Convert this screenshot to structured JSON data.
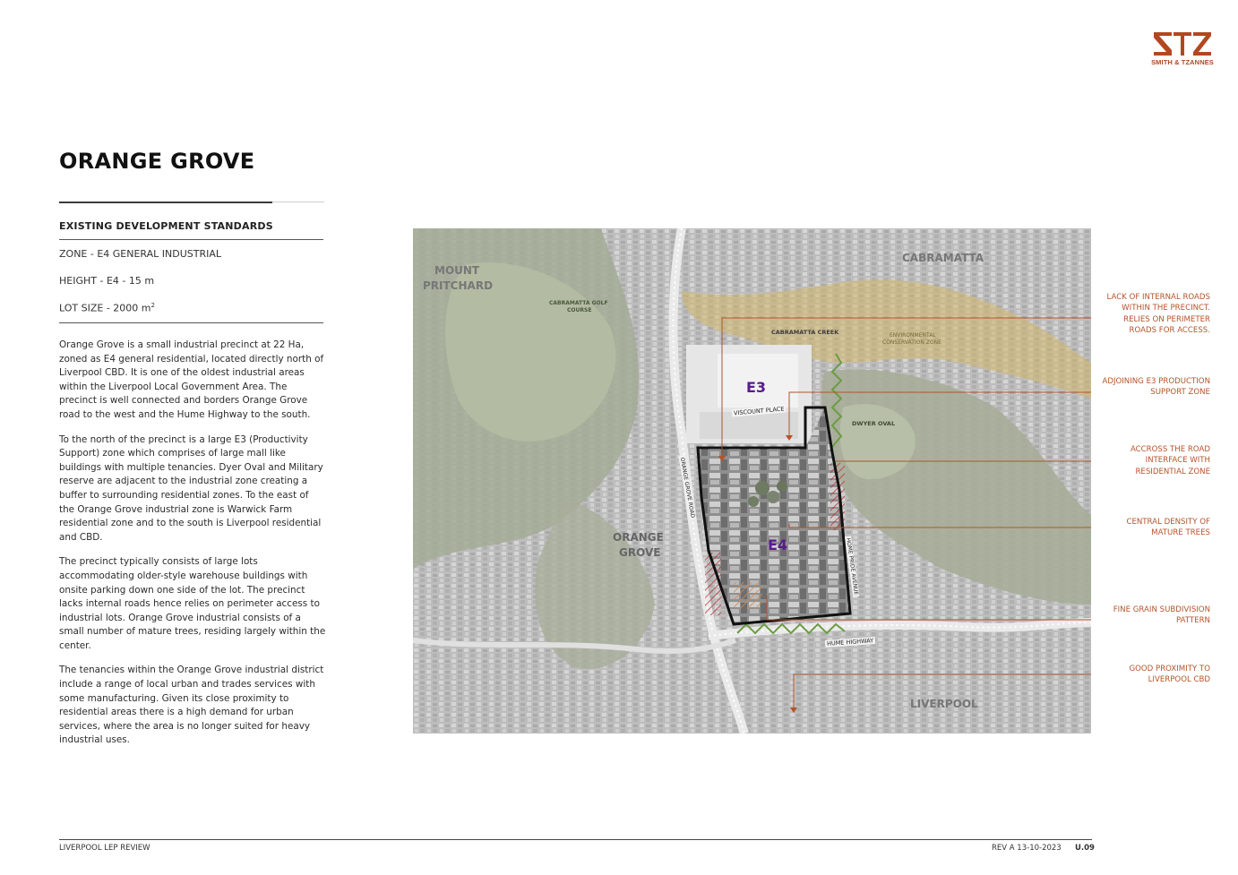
{
  "logo": {
    "text": "SMITH & TZANNES",
    "color": "#b3471f"
  },
  "title": "ORANGE GROVE",
  "standards": {
    "heading": "EXISTING DEVELOPMENT STANDARDS",
    "zone": "ZONE - E4 GENERAL INDUSTRIAL",
    "height": "HEIGHT - E4 - 15 m",
    "lot_size": "LOT SIZE -  2000 m",
    "lot_size_sup": "2"
  },
  "paragraphs": [
    "Orange Grove is a small industrial precinct at 22 Ha, zoned as E4 general residential, located directly north of Liverpool CBD. It is one of the oldest industrial areas within the Liverpool Local Government Area. The precinct is well connected and borders Orange Grove road to the west and the Hume Highway to the south.",
    "To the north of the precinct is a large E3 (Productivity Support) zone which comprises of large mall like buildings with multiple tenancies. Dyer Oval and Military reserve are adjacent to the industrial zone creating a buffer to surrounding residential zones. To the east of the Orange Grove industrial zone is Warwick Farm residential zone and to the south is Liverpool residential and CBD.",
    "The precinct typically consists of large lots accommodating older-style warehouse buildings with onsite parking down one side of the lot. The precinct lacks internal roads hence relies on perimeter access to industrial lots. Orange Grove industrial consists of a small number of mature trees, residing largely within the center.",
    "The tenancies within the Orange Grove industrial district include a range of local urban and trades services with some manufacturing. Given its close proximity to residential areas there is a high demand for urban services, where the area is no longer suited for heavy industrial uses."
  ],
  "map": {
    "labels": {
      "mount": "MOUNT",
      "pritchard": "PRITCHARD",
      "cabramatta": "CABRAMATTA",
      "golf1": "CABRAMATTA GOLF",
      "golf2": "COURSE",
      "creek": "CABRAMATTA CREEK",
      "env1": "ENVIRONMENTAL",
      "env2": "CONSERVATION ZONE",
      "e3": "E3",
      "e4": "E4",
      "viscount": "VISCOUNT PLACE",
      "dwyer": "DWYER OVAL",
      "orange_grove_road": "ORANGE GROVE ROAD",
      "orange": "ORANGE",
      "grove": "GROVE",
      "hume_pride": "HOME PRIDE AVENUE",
      "hume_highway": "HUME HIGHWAY",
      "liverpool": "LIVERPOOL"
    },
    "colors": {
      "zone": "#5a1a8c",
      "callout_line": "#b4532a",
      "green_line": "#6c9c43",
      "hatch": "#c0272d",
      "env": "#d4b76a"
    }
  },
  "callouts": [
    "LACK OF INTERNAL ROADS WITHIN THE PRECINCT. RELIES ON PERIMETER ROADS FOR ACCESS.",
    "ADJOINING E3 PRODUCTION SUPPORT ZONE",
    "ACCROSS THE ROAD INTERFACE WITH RESIDENTIAL ZONE",
    "CENTRAL DENSITY OF MATURE TREES",
    "FINE GRAIN SUBDIVISION PATTERN",
    "GOOD PROXIMITY TO LIVERPOOL CBD"
  ],
  "footer": {
    "left": "LIVERPOOL LEP REVIEW",
    "rev": "REV  A 13-10-2023",
    "page": "U.09"
  }
}
